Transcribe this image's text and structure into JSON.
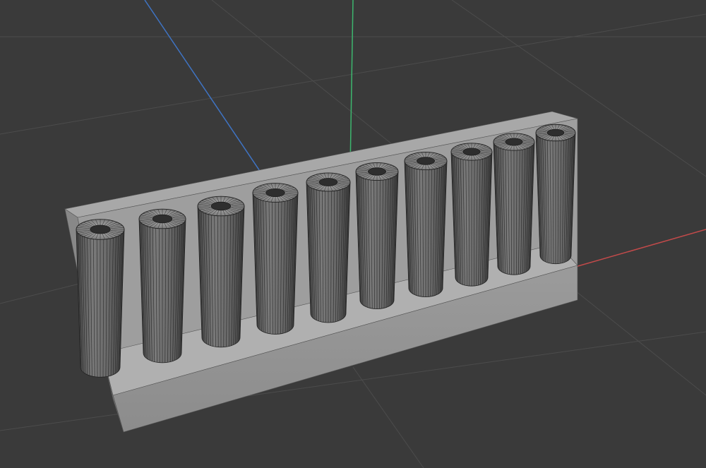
{
  "viewport": {
    "background_color": "#3a3a3a",
    "grid_color": "#4a4a4a",
    "axis_colors": {
      "x": "#c24a4a",
      "y": "#3db66e",
      "z": "#3f74c4"
    }
  },
  "scene": {
    "objects": [
      {
        "name": "base-block",
        "type": "box",
        "color": "#8f8f8f"
      },
      {
        "name": "tube-array",
        "type": "cylinder",
        "count": 10,
        "color": "#6a6a6a"
      }
    ],
    "view_mode": "wireframe-over-solid"
  }
}
